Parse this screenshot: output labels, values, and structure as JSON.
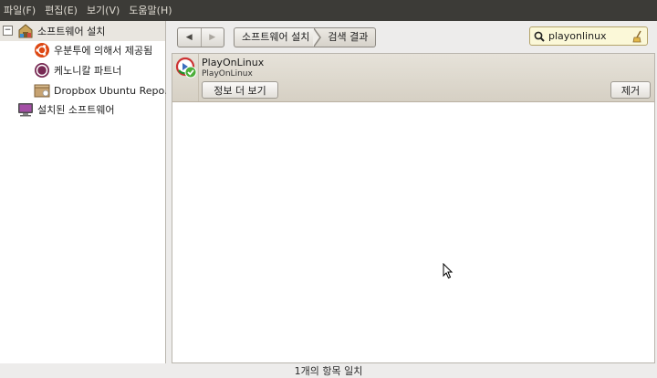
{
  "menubar": {
    "items": [
      "파일(F)",
      "편집(E)",
      "보기(V)",
      "도움말(H)"
    ]
  },
  "sidebar": {
    "root": {
      "label": "소프트웨어 설치",
      "expander": "−",
      "icon": "software-center-icon"
    },
    "children": [
      {
        "label": "우분투에 의해서 제공됨",
        "icon": "ubuntu-icon"
      },
      {
        "label": "케노니칼 파트너",
        "icon": "canonical-partner-icon"
      },
      {
        "label": "Dropbox Ubuntu Repo…",
        "icon": "repository-box-icon"
      }
    ],
    "installed": {
      "label": "설치된 소프트웨어",
      "icon": "computer-icon"
    }
  },
  "toolbar": {
    "back_glyph": "◀",
    "forward_glyph": "▶",
    "breadcrumbs": [
      "소프트웨어 설치",
      "검색 결과"
    ]
  },
  "search": {
    "value": "playonlinux",
    "icon": "search-icon",
    "clear_icon": "clear-broom-icon"
  },
  "results": [
    {
      "name": "PlayOnLinux",
      "summary": "PlayOnLinux",
      "installed": true,
      "more_info_label": "정보 더 보기",
      "remove_label": "제거"
    }
  ],
  "status": {
    "text": "1개의 항목 일치"
  },
  "colors": {
    "menubar_bg": "#3c3b37",
    "search_bg": "#fbf8d8",
    "selected_row_bg": "#e9e6e0",
    "installed_check": "#4cae3a"
  }
}
